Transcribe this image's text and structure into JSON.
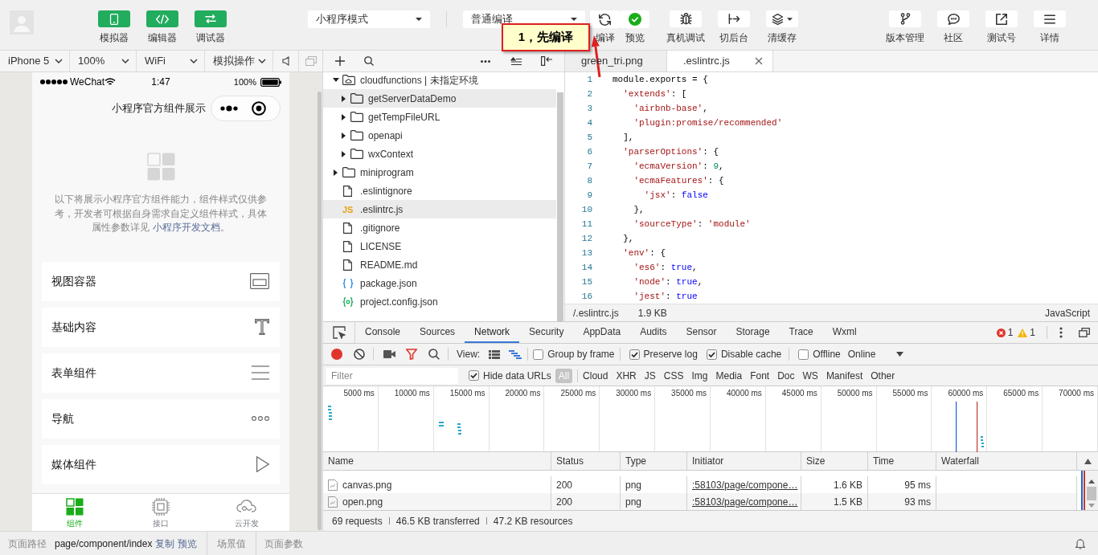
{
  "toolbar": {
    "modes": [
      {
        "label": "模拟器",
        "kind": "simulator",
        "on": true
      },
      {
        "label": "编辑器",
        "kind": "editor",
        "on": true
      },
      {
        "label": "调试器",
        "kind": "debugger",
        "on": true
      }
    ],
    "mode_select": "小程序模式",
    "compile_select": "普通编译",
    "compile_actions": [
      {
        "label": "编译",
        "kind": "compile"
      },
      {
        "label": "预览",
        "kind": "preview"
      }
    ],
    "actions": [
      {
        "label": "真机调试",
        "kind": "remote-debug"
      },
      {
        "label": "切后台",
        "kind": "background"
      },
      {
        "label": "清缓存",
        "kind": "clear-cache"
      }
    ],
    "right_actions": [
      {
        "label": "版本管理",
        "kind": "version"
      },
      {
        "label": "社区",
        "kind": "community"
      },
      {
        "label": "测试号",
        "kind": "test-account"
      },
      {
        "label": "详情",
        "kind": "details"
      }
    ]
  },
  "annotation": {
    "text": "1，先编译"
  },
  "simulator": {
    "device": "iPhone 5",
    "zoom": "100%",
    "network": "WiFi",
    "operation": "模拟操作",
    "phone": {
      "carrier": "WeChat",
      "time": "1:47",
      "battery": "100%",
      "title": "小程序官方组件展示",
      "intro": {
        "text": "以下将展示小程序官方组件能力，组件样式仅供参考，开发者可根据自身需求自定义组件样式，具体属性参数详见 ",
        "link": "小程序开发文档",
        "after": "。"
      },
      "menu": [
        {
          "label": "视图容器",
          "kind": "view"
        },
        {
          "label": "基础内容",
          "kind": "text"
        },
        {
          "label": "表单组件",
          "kind": "form"
        },
        {
          "label": "导航",
          "kind": "nav"
        },
        {
          "label": "媒体组件",
          "kind": "media"
        }
      ],
      "tabbar": [
        {
          "label": "组件",
          "kind": "components",
          "selected": true
        },
        {
          "label": "接口",
          "kind": "api",
          "selected": false
        },
        {
          "label": "云开发",
          "kind": "cloud",
          "selected": false
        }
      ]
    }
  },
  "file_tree": [
    {
      "name": "cloudfunctions | 未指定环境",
      "kind": "cloud-folder",
      "expanded": true,
      "selected": false,
      "children": [
        {
          "name": "getServerDataDemo",
          "kind": "folder",
          "expanded": false,
          "selected": true
        },
        {
          "name": "getTempFileURL",
          "kind": "folder",
          "expanded": false,
          "selected": false
        },
        {
          "name": "openapi",
          "kind": "folder",
          "expanded": false,
          "selected": false
        },
        {
          "name": "wxContext",
          "kind": "folder",
          "expanded": false,
          "selected": false
        }
      ]
    },
    {
      "name": "miniprogram",
      "kind": "folder",
      "expanded": false,
      "selected": false
    },
    {
      "name": ".eslintignore",
      "kind": "file",
      "selected": false
    },
    {
      "name": ".eslintrc.js",
      "kind": "js",
      "badge": "JS",
      "selected": true
    },
    {
      "name": ".gitignore",
      "kind": "file",
      "selected": false
    },
    {
      "name": "LICENSE",
      "kind": "file",
      "selected": false
    },
    {
      "name": "README.md",
      "kind": "file",
      "selected": false
    },
    {
      "name": "package.json",
      "kind": "json",
      "selected": false
    },
    {
      "name": "project.config.json",
      "kind": "config",
      "selected": false
    }
  ],
  "editor": {
    "tabs": [
      {
        "label": "green_tri.png",
        "selected": false
      },
      {
        "label": ".eslintrc.js",
        "selected": true
      }
    ],
    "lines": [
      {
        "number": "1",
        "tokens": [
          {
            "text": "module.exports = {",
            "kind": "plain"
          }
        ]
      },
      {
        "number": "2",
        "tokens": [
          {
            "text": "  'extends'",
            "kind": "string"
          },
          {
            "text": ": [",
            "kind": "plain"
          }
        ]
      },
      {
        "number": "3",
        "tokens": [
          {
            "text": "    'airbnb-base'",
            "kind": "string"
          },
          {
            "text": ",",
            "kind": "plain"
          }
        ]
      },
      {
        "number": "4",
        "tokens": [
          {
            "text": "    'plugin:promise/recommended'",
            "kind": "string"
          }
        ]
      },
      {
        "number": "5",
        "tokens": [
          {
            "text": "  ],",
            "kind": "plain"
          }
        ]
      },
      {
        "number": "6",
        "tokens": [
          {
            "text": "  'parserOptions'",
            "kind": "string"
          },
          {
            "text": ": {",
            "kind": "plain"
          }
        ]
      },
      {
        "number": "7",
        "tokens": [
          {
            "text": "    'ecmaVersion'",
            "kind": "string"
          },
          {
            "text": ": ",
            "kind": "plain"
          },
          {
            "text": "9",
            "kind": "number"
          },
          {
            "text": ",",
            "kind": "plain"
          }
        ]
      },
      {
        "number": "8",
        "tokens": [
          {
            "text": "    'ecmaFeatures'",
            "kind": "string"
          },
          {
            "text": ": {",
            "kind": "plain"
          }
        ]
      },
      {
        "number": "9",
        "tokens": [
          {
            "text": "      'jsx'",
            "kind": "string"
          },
          {
            "text": ": ",
            "kind": "plain"
          },
          {
            "text": "false",
            "kind": "keyword"
          }
        ]
      },
      {
        "number": "10",
        "tokens": [
          {
            "text": "    },",
            "kind": "plain"
          }
        ]
      },
      {
        "number": "11",
        "tokens": [
          {
            "text": "    'sourceType'",
            "kind": "string"
          },
          {
            "text": ": ",
            "kind": "plain"
          },
          {
            "text": "'module'",
            "kind": "string"
          }
        ]
      },
      {
        "number": "12",
        "tokens": [
          {
            "text": "  },",
            "kind": "plain"
          }
        ]
      },
      {
        "number": "13",
        "tokens": [
          {
            "text": "  'env'",
            "kind": "string"
          },
          {
            "text": ": {",
            "kind": "plain"
          }
        ]
      },
      {
        "number": "14",
        "tokens": [
          {
            "text": "    'es6'",
            "kind": "string"
          },
          {
            "text": ": ",
            "kind": "plain"
          },
          {
            "text": "true",
            "kind": "keyword"
          },
          {
            "text": ",",
            "kind": "plain"
          }
        ]
      },
      {
        "number": "15",
        "tokens": [
          {
            "text": "    'node'",
            "kind": "string"
          },
          {
            "text": ": ",
            "kind": "plain"
          },
          {
            "text": "true",
            "kind": "keyword"
          },
          {
            "text": ",",
            "kind": "plain"
          }
        ]
      },
      {
        "number": "16",
        "tokens": [
          {
            "text": "    'jest'",
            "kind": "string"
          },
          {
            "text": ": ",
            "kind": "plain"
          },
          {
            "text": "true",
            "kind": "keyword"
          }
        ]
      }
    ],
    "status": {
      "path": "/.eslintrc.js",
      "size": "1.9 KB",
      "language": "JavaScript"
    }
  },
  "devtools": {
    "tabs": [
      {
        "label": "Console",
        "selected": false
      },
      {
        "label": "Sources",
        "selected": false
      },
      {
        "label": "Network",
        "selected": true
      },
      {
        "label": "Security",
        "selected": false
      },
      {
        "label": "AppData",
        "selected": false
      },
      {
        "label": "Audits",
        "selected": false
      },
      {
        "label": "Sensor",
        "selected": false
      },
      {
        "label": "Storage",
        "selected": false
      },
      {
        "label": "Trace",
        "selected": false
      },
      {
        "label": "Wxml",
        "selected": false
      }
    ],
    "errors": "1",
    "warnings": "1",
    "toolbar": {
      "recording": true,
      "filter_active": true,
      "view_label": "View:",
      "view_modes": [
        {
          "kind": "list",
          "selected": false
        },
        {
          "kind": "waterfall",
          "selected": true
        }
      ],
      "options": [
        {
          "label": "Group by frame",
          "checked": false
        },
        {
          "label": "Preserve log",
          "checked": true
        },
        {
          "label": "Disable cache",
          "checked": true
        }
      ],
      "offline": {
        "label": "Offline",
        "checked": false
      },
      "throttle": "Online"
    },
    "filter": {
      "placeholder": "Filter",
      "hide_data_urls": {
        "label": "Hide data URLs",
        "checked": true
      },
      "types": [
        {
          "label": "All",
          "selected": true
        },
        {
          "label": "Cloud",
          "selected": false
        },
        {
          "label": "XHR",
          "selected": false
        },
        {
          "label": "JS",
          "selected": false
        },
        {
          "label": "CSS",
          "selected": false
        },
        {
          "label": "Img",
          "selected": false
        },
        {
          "label": "Media",
          "selected": false
        },
        {
          "label": "Font",
          "selected": false
        },
        {
          "label": "Doc",
          "selected": false
        },
        {
          "label": "WS",
          "selected": false
        },
        {
          "label": "Manifest",
          "selected": false
        },
        {
          "label": "Other",
          "selected": false
        }
      ]
    },
    "overview": {
      "ticks": [
        "5000 ms",
        "10000 ms",
        "15000 ms",
        "20000 ms",
        "25000 ms",
        "30000 ms",
        "35000 ms",
        "40000 ms",
        "45000 ms",
        "50000 ms",
        "55000 ms",
        "60000 ms",
        "65000 ms",
        "70000 ms"
      ]
    },
    "table": {
      "columns": [
        "Name",
        "Status",
        "Type",
        "Initiator",
        "Size",
        "Time",
        "Waterfall"
      ],
      "rows": [
        {
          "name": "canvas.png",
          "status": "200",
          "type": "png",
          "initiator": ":58103/page/compone…",
          "size": "1.6 KB",
          "time": "95 ms"
        },
        {
          "name": "open.png",
          "status": "200",
          "type": "png",
          "initiator": ":58103/page/compone…",
          "size": "1.5 KB",
          "time": "93 ms"
        }
      ]
    },
    "summary": [
      "69 requests",
      "46.5 KB transferred",
      "47.2 KB resources"
    ]
  },
  "bottom_bar": {
    "path_label": "页面路径",
    "path": "page/component/index",
    "links": [
      "复制",
      "预览"
    ],
    "scene": "场景值",
    "params": "页面参数"
  }
}
